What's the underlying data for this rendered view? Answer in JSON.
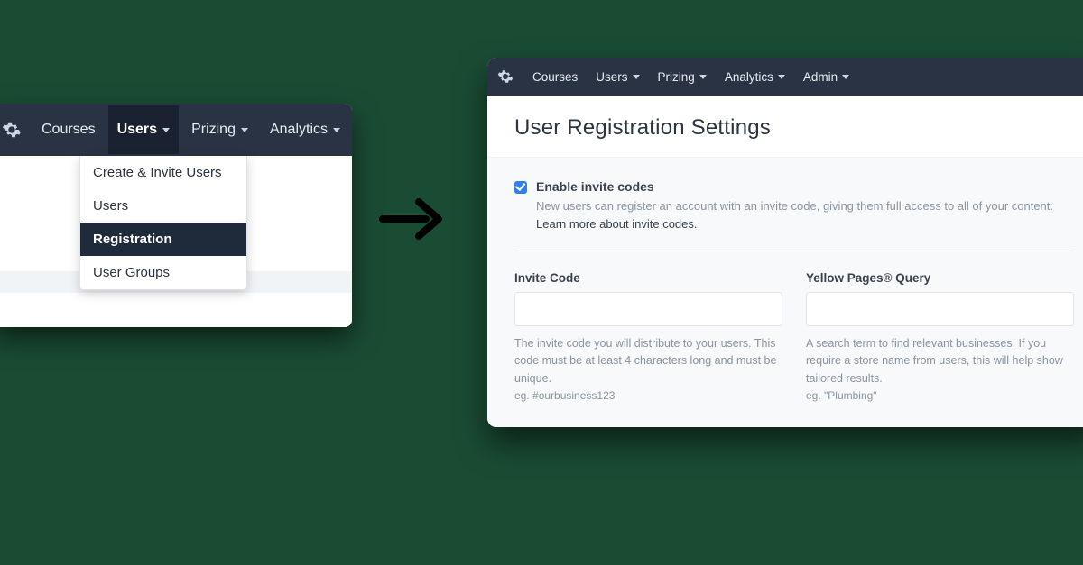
{
  "left": {
    "nav": {
      "courses": "Courses",
      "users": "Users",
      "prizing": "Prizing",
      "analytics": "Analytics"
    },
    "dropdown": {
      "create_invite": "Create & Invite Users",
      "users": "Users",
      "registration": "Registration",
      "user_groups": "User Groups"
    }
  },
  "right": {
    "nav": {
      "courses": "Courses",
      "users": "Users",
      "prizing": "Prizing",
      "analytics": "Analytics",
      "admin": "Admin"
    },
    "page_title": "User Registration Settings",
    "enable_label": "Enable invite codes",
    "enable_help": "New users can register an account with an invite code, giving them full access to all of your content. ",
    "learn_more": "Learn more about invite codes.",
    "invite_code": {
      "label": "Invite Code",
      "help": "The invite code you will distribute to your users. This code must be at least 4 characters long and must be unique.",
      "eg": "eg. #ourbusiness123"
    },
    "yp_query": {
      "label": "Yellow Pages® Query",
      "help": "A search term to find relevant businesses. If you require a store name from users, this will help show tailored results.",
      "eg": "eg. \"Plumbing\""
    }
  }
}
